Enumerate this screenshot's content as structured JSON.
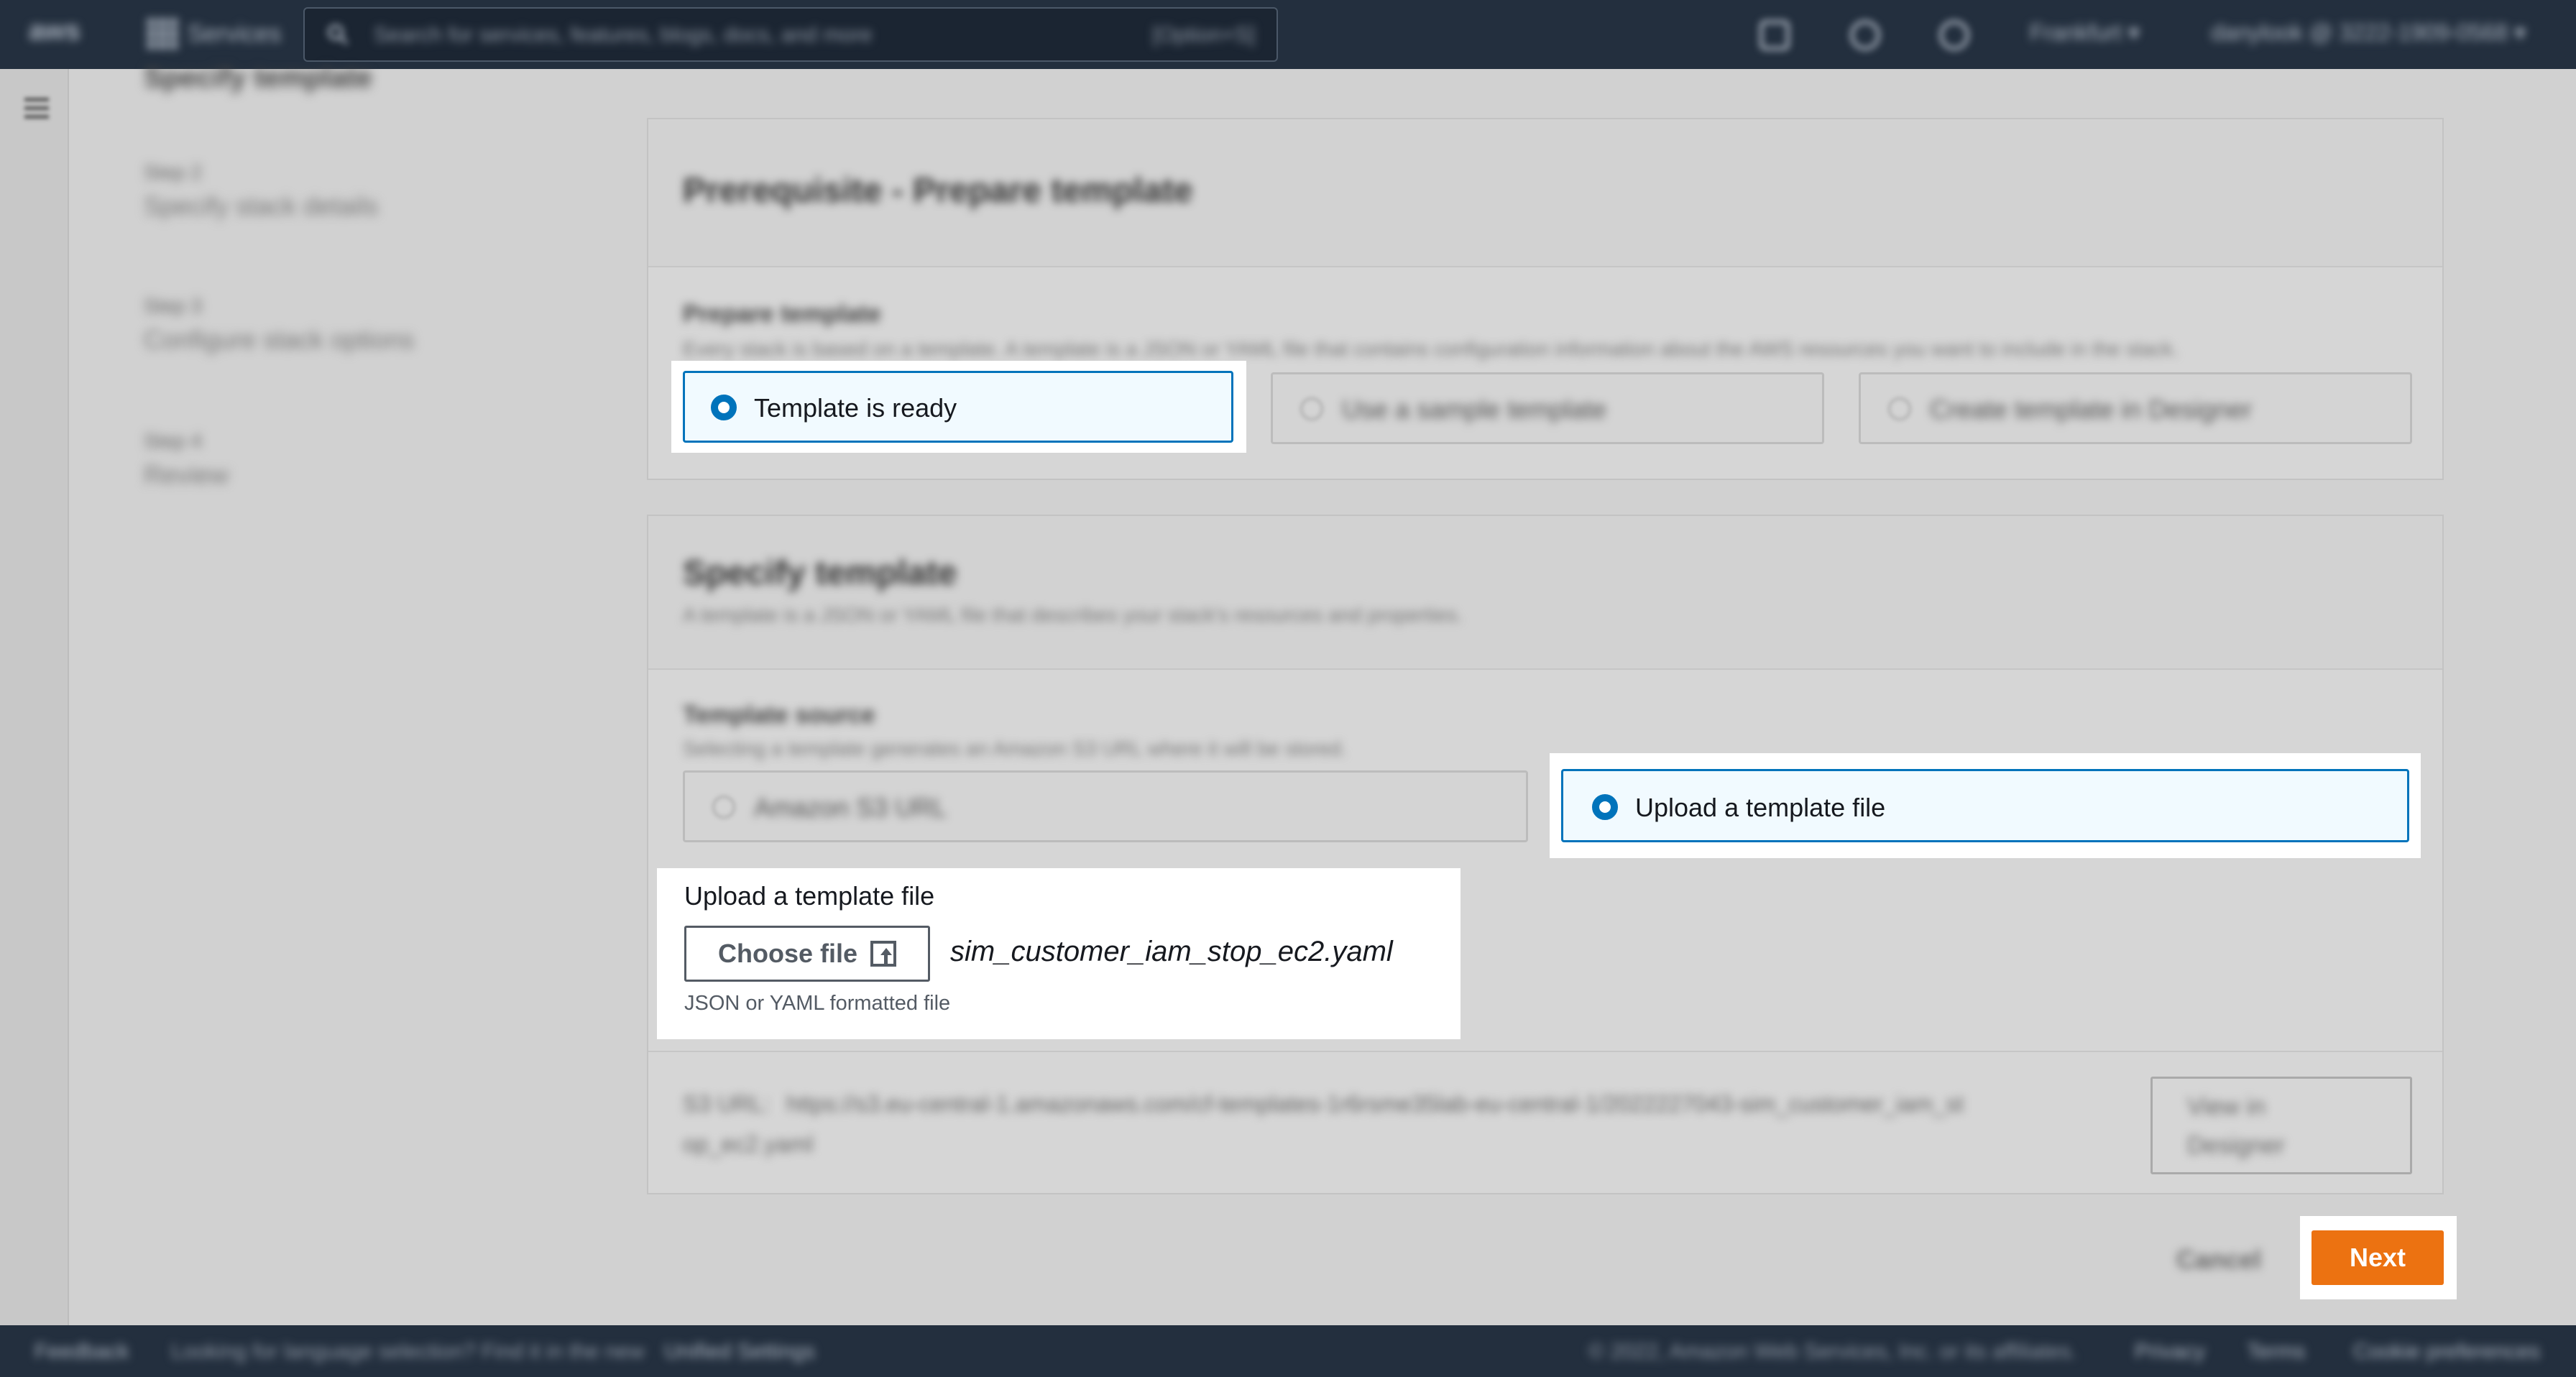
{
  "nav": {
    "logo": "aws",
    "services": "Services",
    "search_placeholder": "Search for services, features, blogs, docs, and more",
    "search_shortcut": "[Option+S]",
    "region": "Frankfurt ▾",
    "account": "danylook @ 3222-1909-0568 ▾"
  },
  "steps": {
    "current_cut": "Specify template",
    "items": [
      {
        "step": "Step 2",
        "title": "Specify stack details"
      },
      {
        "step": "Step 3",
        "title": "Configure stack options"
      },
      {
        "step": "Step 4",
        "title": "Review"
      }
    ]
  },
  "prereq": {
    "title": "Prerequisite - Prepare template",
    "label": "Prepare template",
    "description": "Every stack is based on a template. A template is a JSON or YAML file that contains configuration information about the AWS resources you want to include in the stack.",
    "options": [
      "Template is ready",
      "Use a sample template",
      "Create template in Designer"
    ]
  },
  "specify": {
    "title": "Specify template",
    "description": "A template is a JSON or YAML file that describes your stack's resources and properties.",
    "source_label": "Template source",
    "source_desc": "Selecting a template generates an Amazon S3 URL where it will be stored.",
    "options": [
      "Amazon S3 URL",
      "Upload a template file"
    ],
    "upload_label": "Upload a template file",
    "choose_file": "Choose file",
    "filename": "sim_customer_iam_stop_ec2.yaml",
    "hint": "JSON or YAML formatted file",
    "s3_label": "S3 URL:",
    "s3_url_line1": "https://s3.eu-central-1.amazonaws.com/cf-templates-1r6rsme35lab-eu-central-1/2022227043-sim_customer_iam_st",
    "s3_url_line2": "op_ec2.yaml",
    "view_designer_1": "View in",
    "view_designer_2": "Designer"
  },
  "actions": {
    "cancel": "Cancel",
    "next": "Next"
  },
  "footer": {
    "feedback": "Feedback",
    "language": "Looking for language selection? Find it in the new",
    "unified": "Unified Settings",
    "copyright": "© 2022, Amazon Web Services, Inc. or its affiliates.",
    "privacy": "Privacy",
    "terms": "Terms",
    "cookies": "Cookie preferences"
  }
}
